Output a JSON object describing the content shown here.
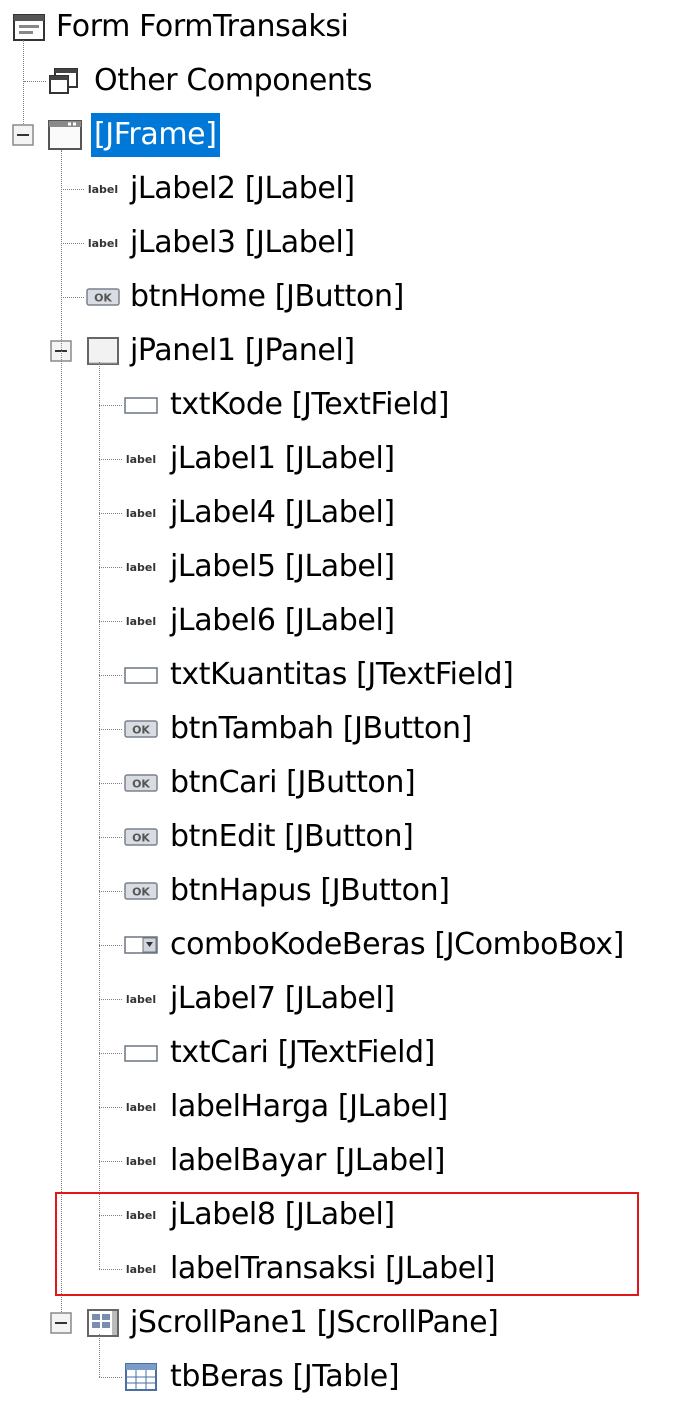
{
  "tree": {
    "root": {
      "label": "Form FormTransaksi",
      "icon": "form-icon"
    },
    "other_components": {
      "label": "Other Components",
      "icon": "other-components-icon"
    },
    "frame": {
      "label": "[JFrame]",
      "icon": "frame-icon",
      "selected": true
    },
    "frame_children": [
      {
        "label": "jLabel2 [JLabel]",
        "icon": "label-icon"
      },
      {
        "label": "jLabel3 [JLabel]",
        "icon": "label-icon"
      },
      {
        "label": "btnHome [JButton]",
        "icon": "button-icon"
      }
    ],
    "panel": {
      "label": "jPanel1 [JPanel]",
      "icon": "panel-icon"
    },
    "panel_children": [
      {
        "label": "txtKode [JTextField]",
        "icon": "textfield-icon"
      },
      {
        "label": "jLabel1 [JLabel]",
        "icon": "label-icon"
      },
      {
        "label": "jLabel4 [JLabel]",
        "icon": "label-icon"
      },
      {
        "label": "jLabel5 [JLabel]",
        "icon": "label-icon"
      },
      {
        "label": "jLabel6 [JLabel]",
        "icon": "label-icon"
      },
      {
        "label": "txtKuantitas [JTextField]",
        "icon": "textfield-icon"
      },
      {
        "label": "btnTambah [JButton]",
        "icon": "button-icon"
      },
      {
        "label": "btnCari [JButton]",
        "icon": "button-icon"
      },
      {
        "label": "btnEdit [JButton]",
        "icon": "button-icon"
      },
      {
        "label": "btnHapus [JButton]",
        "icon": "button-icon"
      },
      {
        "label": "comboKodeBeras [JComboBox]",
        "icon": "combobox-icon"
      },
      {
        "label": "jLabel7 [JLabel]",
        "icon": "label-icon"
      },
      {
        "label": "txtCari [JTextField]",
        "icon": "textfield-icon"
      },
      {
        "label": "labelHarga [JLabel]",
        "icon": "label-icon"
      },
      {
        "label": "labelBayar [JLabel]",
        "icon": "label-icon"
      },
      {
        "label": "jLabel8 [JLabel]",
        "icon": "label-icon"
      },
      {
        "label": "labelTransaksi [JLabel]",
        "icon": "label-icon"
      }
    ],
    "scrollpane": {
      "label": "jScrollPane1 [JScrollPane]",
      "icon": "scrollpane-icon"
    },
    "scrollpane_children": [
      {
        "label": "tbBeras [JTable]",
        "icon": "table-icon"
      }
    ]
  },
  "icon_text": {
    "label_glyph": "label",
    "button_glyph": "OK"
  },
  "colors": {
    "selection": "#0078d7",
    "highlight_border": "#e0171b",
    "tree_line": "#808080"
  }
}
